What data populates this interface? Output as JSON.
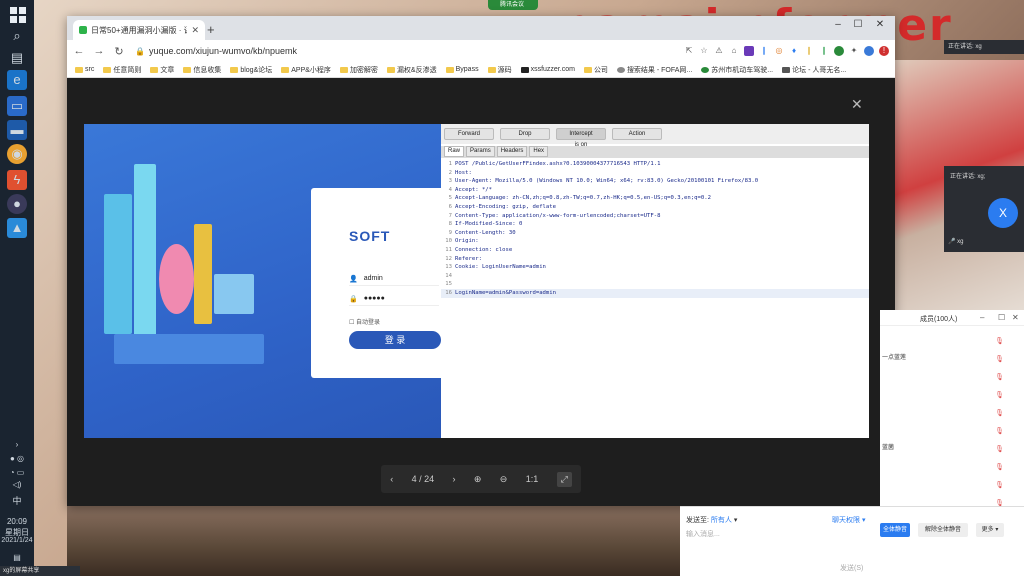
{
  "meeting_pill": "腾讯会议",
  "wall_sign": "namai nformer",
  "taskbar": {
    "time": "20:09",
    "weekday": "星期日",
    "date": "2021/1/24",
    "ime": "中",
    "bottom_status": "xg的屏幕共享"
  },
  "browser": {
    "tab_title": "日常50+通用漏洞小漏版 · 语雀",
    "url": "yuque.com/xiujun-wumvo/kb/npuemk",
    "window_controls": [
      "–",
      "☐",
      "✕"
    ],
    "bookmarks": [
      "src",
      "任意简则",
      "文章",
      "信息收集",
      "blog&论坛",
      "APP&小程序",
      "加密解密",
      "漏权&反渗透",
      "Bypass",
      "源码",
      "xssfuzzer.com",
      "公司",
      "搜索结果 - FOFA网...",
      "苏州市机动车驾驶...",
      "论坛 - 人哥无名..."
    ]
  },
  "viewer": {
    "page_indicator": "4 / 24",
    "zoom_reset": "1:1"
  },
  "login_page": {
    "logo_text": "SOFT",
    "username": "admin",
    "password_mask": "●●●●●",
    "remember_label": "自动登录",
    "login_button": "登 录"
  },
  "burp": {
    "buttons": [
      "Forward",
      "Drop",
      "Intercept is on",
      "Action"
    ],
    "tabs": [
      "Raw",
      "Params",
      "Headers",
      "Hex"
    ],
    "request_lines": [
      "POST /Public/GetUserFFindex.ashx?0.10390004377716543 HTTP/1.1",
      "Host: ",
      "User-Agent: Mozilla/5.0 (Windows NT 10.0; Win64; x64; rv:83.0) Gecko/20100101 Firefox/83.0",
      "Accept: */*",
      "Accept-Language: zh-CN,zh;q=0.8,zh-TW;q=0.7,zh-HK;q=0.5,en-US;q=0.3,en;q=0.2",
      "Accept-Encoding: gzip, deflate",
      "Content-Type: application/x-www-form-urlencoded;charset=UTF-8",
      "If-Modified-Since: 0",
      "Content-Length: 30",
      "Origin: ",
      "Connection: close",
      "Referer: ",
      "Cookie: LoginUserName=admin",
      "",
      "",
      "LoginName=admin&Password=admin"
    ]
  },
  "meeting": {
    "mini_bar": "正在讲话: xg",
    "speaker_title": "正在讲话: xg;",
    "speaker_initial": "X",
    "speaker_name": "xg",
    "members_title": "成员(100人)",
    "member_rows": [
      "",
      "一点蓝莲",
      "",
      "",
      "",
      "",
      "蓝菌",
      "",
      "",
      ""
    ],
    "chat_to_label": "发送至:",
    "chat_to_value": "所有人",
    "chat_perm": "聊天权限",
    "chat_placeholder": "输入消息...",
    "chat_send": "发送(S)",
    "mute_all": "全体静音",
    "unmute_all": "解除全体静音",
    "more": "更多"
  }
}
